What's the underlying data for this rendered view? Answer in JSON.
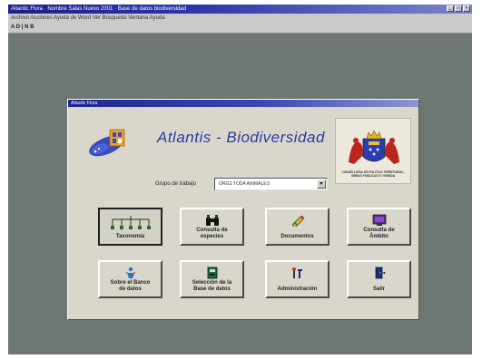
{
  "window": {
    "title": "Atlantic Flora · Nombre Salas Nuevo 2001 · Base de datos biodiversidad",
    "menu": "Archivo  Acciones  Ayuda de Word  Ver  Búsqueda  Ventana  Ayuda",
    "toolbar": "A D  |  N  B"
  },
  "dialog": {
    "caption": "Atlantic Flora",
    "app_title": "Atlantis - Biodiversidad",
    "crest_text": "CONSELLERIA DE POLITICA TERRITORIAL, OBRAS PUBLICAS E VIVENDA",
    "grupo_label": "Grupo de trabajo",
    "grupo_value": "ORGS TODA ANIMALES"
  },
  "buttons": [
    {
      "label": "Taxonomía",
      "icon": "tree-diagram-icon"
    },
    {
      "label": "Consulta de\nespecies",
      "icon": "binoculars-icon"
    },
    {
      "label": "Documentos",
      "icon": "pencil-icon"
    },
    {
      "label": "Consulta de\nÁmbito",
      "icon": "monitor-icon"
    },
    {
      "label": "Sobre el Banco\nde datos",
      "icon": "info-person-icon"
    },
    {
      "label": "Selección de la\nBase de datos",
      "icon": "database-icon"
    },
    {
      "label": "Administración",
      "icon": "tools-icon"
    },
    {
      "label": "Salir",
      "icon": "exit-door-icon"
    }
  ],
  "colors": {
    "desktop": "#6e7773",
    "dialog_bg": "#d9d7cb",
    "title_blue": "#2a3aa0",
    "titlebar": "#1e2691"
  }
}
